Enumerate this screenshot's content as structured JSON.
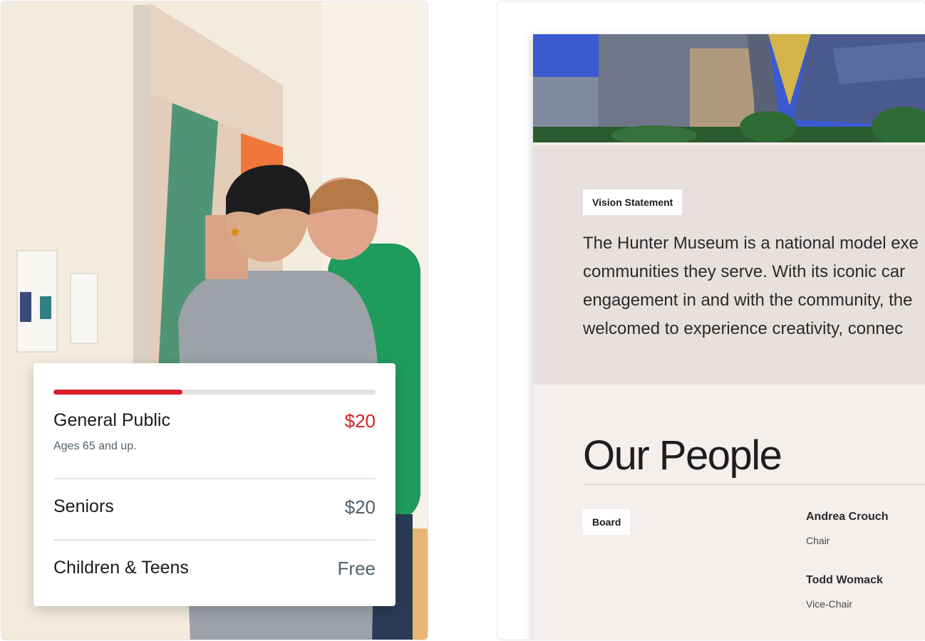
{
  "pricing": {
    "progress_fraction": 0.4,
    "rows": [
      {
        "name": "General Public",
        "price": "$20",
        "note": "Ages 65 and up."
      },
      {
        "name": "Seniors",
        "price": "$20"
      },
      {
        "name": "Children & Teens",
        "price": "Free"
      }
    ]
  },
  "site": {
    "vision_tag": "Vision Statement",
    "vision_lines": [
      "The Hunter Museum is a national model exe",
      "communities they serve. With its iconic car",
      "engagement in and with the community, the",
      "welcomed to experience creativity, connec"
    ],
    "people_title": "Our People",
    "board_tag": "Board",
    "members": [
      {
        "name": "Andrea Crouch",
        "role": "Chair"
      },
      {
        "name": "Todd Womack",
        "role": "Vice-Chair"
      }
    ]
  },
  "colors": {
    "accent": "#d91f26",
    "muted": "#51606b",
    "vision_bg": "#e8e0de",
    "site_bg": "#f4efed"
  }
}
